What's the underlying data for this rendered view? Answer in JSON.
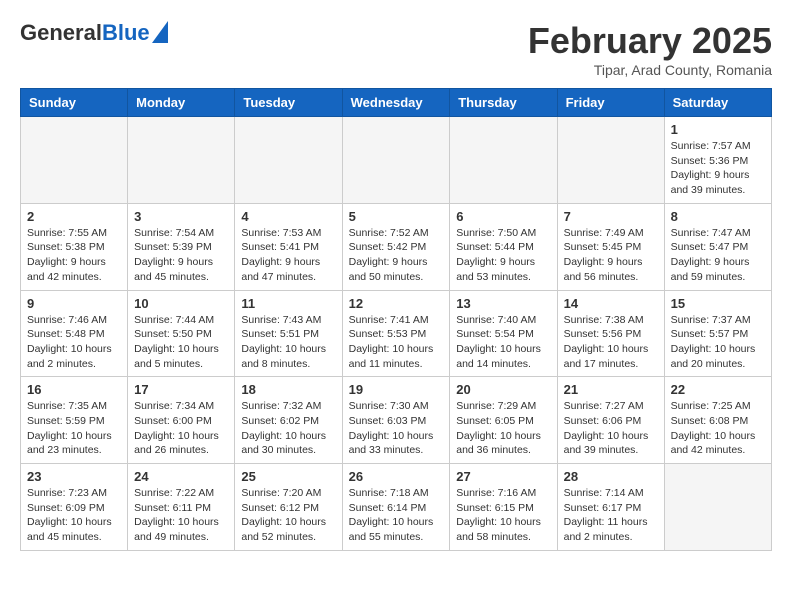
{
  "header": {
    "logo_general": "General",
    "logo_blue": "Blue",
    "month_title": "February 2025",
    "location": "Tipar, Arad County, Romania"
  },
  "weekdays": [
    "Sunday",
    "Monday",
    "Tuesday",
    "Wednesday",
    "Thursday",
    "Friday",
    "Saturday"
  ],
  "weeks": [
    [
      {
        "day": "",
        "info": ""
      },
      {
        "day": "",
        "info": ""
      },
      {
        "day": "",
        "info": ""
      },
      {
        "day": "",
        "info": ""
      },
      {
        "day": "",
        "info": ""
      },
      {
        "day": "",
        "info": ""
      },
      {
        "day": "1",
        "info": "Sunrise: 7:57 AM\nSunset: 5:36 PM\nDaylight: 9 hours and 39 minutes."
      }
    ],
    [
      {
        "day": "2",
        "info": "Sunrise: 7:55 AM\nSunset: 5:38 PM\nDaylight: 9 hours and 42 minutes."
      },
      {
        "day": "3",
        "info": "Sunrise: 7:54 AM\nSunset: 5:39 PM\nDaylight: 9 hours and 45 minutes."
      },
      {
        "day": "4",
        "info": "Sunrise: 7:53 AM\nSunset: 5:41 PM\nDaylight: 9 hours and 47 minutes."
      },
      {
        "day": "5",
        "info": "Sunrise: 7:52 AM\nSunset: 5:42 PM\nDaylight: 9 hours and 50 minutes."
      },
      {
        "day": "6",
        "info": "Sunrise: 7:50 AM\nSunset: 5:44 PM\nDaylight: 9 hours and 53 minutes."
      },
      {
        "day": "7",
        "info": "Sunrise: 7:49 AM\nSunset: 5:45 PM\nDaylight: 9 hours and 56 minutes."
      },
      {
        "day": "8",
        "info": "Sunrise: 7:47 AM\nSunset: 5:47 PM\nDaylight: 9 hours and 59 minutes."
      }
    ],
    [
      {
        "day": "9",
        "info": "Sunrise: 7:46 AM\nSunset: 5:48 PM\nDaylight: 10 hours and 2 minutes."
      },
      {
        "day": "10",
        "info": "Sunrise: 7:44 AM\nSunset: 5:50 PM\nDaylight: 10 hours and 5 minutes."
      },
      {
        "day": "11",
        "info": "Sunrise: 7:43 AM\nSunset: 5:51 PM\nDaylight: 10 hours and 8 minutes."
      },
      {
        "day": "12",
        "info": "Sunrise: 7:41 AM\nSunset: 5:53 PM\nDaylight: 10 hours and 11 minutes."
      },
      {
        "day": "13",
        "info": "Sunrise: 7:40 AM\nSunset: 5:54 PM\nDaylight: 10 hours and 14 minutes."
      },
      {
        "day": "14",
        "info": "Sunrise: 7:38 AM\nSunset: 5:56 PM\nDaylight: 10 hours and 17 minutes."
      },
      {
        "day": "15",
        "info": "Sunrise: 7:37 AM\nSunset: 5:57 PM\nDaylight: 10 hours and 20 minutes."
      }
    ],
    [
      {
        "day": "16",
        "info": "Sunrise: 7:35 AM\nSunset: 5:59 PM\nDaylight: 10 hours and 23 minutes."
      },
      {
        "day": "17",
        "info": "Sunrise: 7:34 AM\nSunset: 6:00 PM\nDaylight: 10 hours and 26 minutes."
      },
      {
        "day": "18",
        "info": "Sunrise: 7:32 AM\nSunset: 6:02 PM\nDaylight: 10 hours and 30 minutes."
      },
      {
        "day": "19",
        "info": "Sunrise: 7:30 AM\nSunset: 6:03 PM\nDaylight: 10 hours and 33 minutes."
      },
      {
        "day": "20",
        "info": "Sunrise: 7:29 AM\nSunset: 6:05 PM\nDaylight: 10 hours and 36 minutes."
      },
      {
        "day": "21",
        "info": "Sunrise: 7:27 AM\nSunset: 6:06 PM\nDaylight: 10 hours and 39 minutes."
      },
      {
        "day": "22",
        "info": "Sunrise: 7:25 AM\nSunset: 6:08 PM\nDaylight: 10 hours and 42 minutes."
      }
    ],
    [
      {
        "day": "23",
        "info": "Sunrise: 7:23 AM\nSunset: 6:09 PM\nDaylight: 10 hours and 45 minutes."
      },
      {
        "day": "24",
        "info": "Sunrise: 7:22 AM\nSunset: 6:11 PM\nDaylight: 10 hours and 49 minutes."
      },
      {
        "day": "25",
        "info": "Sunrise: 7:20 AM\nSunset: 6:12 PM\nDaylight: 10 hours and 52 minutes."
      },
      {
        "day": "26",
        "info": "Sunrise: 7:18 AM\nSunset: 6:14 PM\nDaylight: 10 hours and 55 minutes."
      },
      {
        "day": "27",
        "info": "Sunrise: 7:16 AM\nSunset: 6:15 PM\nDaylight: 10 hours and 58 minutes."
      },
      {
        "day": "28",
        "info": "Sunrise: 7:14 AM\nSunset: 6:17 PM\nDaylight: 11 hours and 2 minutes."
      },
      {
        "day": "",
        "info": ""
      }
    ]
  ]
}
